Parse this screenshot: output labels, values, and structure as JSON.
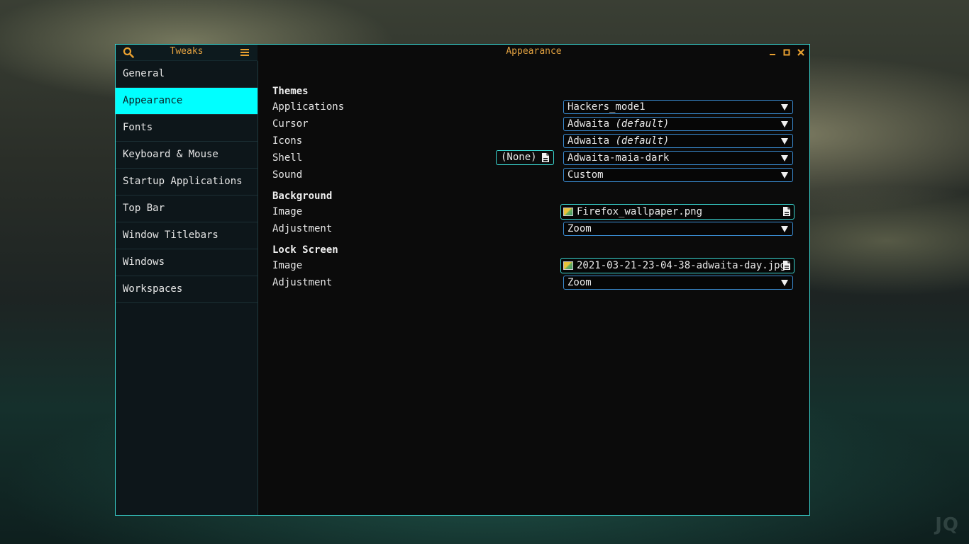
{
  "sidebar": {
    "title": "Tweaks",
    "items": [
      {
        "label": "General"
      },
      {
        "label": "Appearance"
      },
      {
        "label": "Fonts"
      },
      {
        "label": "Keyboard & Mouse"
      },
      {
        "label": "Startup Applications"
      },
      {
        "label": "Top Bar"
      },
      {
        "label": "Window Titlebars"
      },
      {
        "label": "Windows"
      },
      {
        "label": "Workspaces"
      }
    ],
    "active": "Appearance"
  },
  "header": {
    "title": "Appearance",
    "icons": [
      "search-icon",
      "menu-icon",
      "minimize-icon",
      "maximize-icon",
      "close-icon"
    ]
  },
  "themes": {
    "title": "Themes",
    "applications": {
      "label": "Applications",
      "value": "Hackers_mode1"
    },
    "cursor": {
      "label": "Cursor",
      "value": "Adwaita",
      "suffix": "(default)"
    },
    "icons": {
      "label": "Icons",
      "value": "Adwaita",
      "suffix": "(default)"
    },
    "shell": {
      "label": "Shell",
      "value": "Adwaita-maia-dark",
      "file_button": "(None)"
    },
    "sound": {
      "label": "Sound",
      "value": "Custom"
    }
  },
  "background": {
    "title": "Background",
    "image": {
      "label": "Image",
      "value": "Firefox_wallpaper.png"
    },
    "adjustment": {
      "label": "Adjustment",
      "value": "Zoom"
    }
  },
  "lock_screen": {
    "title": "Lock Screen",
    "image": {
      "label": "Image",
      "value": "2021-03-21-23-04-38-adwaita-day.jpg"
    },
    "adjustment": {
      "label": "Adjustment",
      "value": "Zoom"
    }
  },
  "watermark": "JQ",
  "colors": {
    "accent": "#00ffff",
    "title_text": "#e0a040",
    "border": "#3ad7d2",
    "combo_border": "#3a8bd0"
  }
}
